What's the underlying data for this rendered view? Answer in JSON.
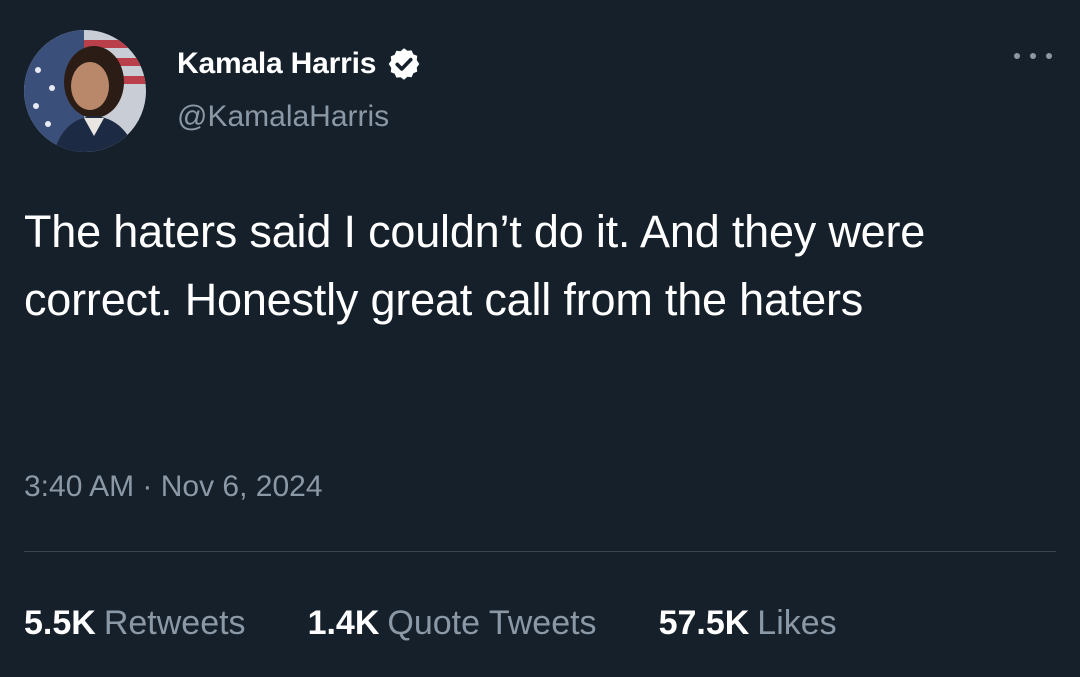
{
  "author": {
    "display_name": "Kamala Harris",
    "handle": "@KamalaHarris",
    "verified": true
  },
  "tweet": {
    "text": "The haters said I couldn’t do it. And they were correct. Honestly great call from the haters",
    "timestamp": "3:40 AM · Nov 6, 2024"
  },
  "stats": [
    {
      "count": "5.5K",
      "label": "Retweets"
    },
    {
      "count": "1.4K",
      "label": "Quote Tweets"
    },
    {
      "count": "57.5K",
      "label": "Likes"
    }
  ],
  "icons": {
    "verified": "verified-badge-icon",
    "more": "more-options-icon"
  },
  "colors": {
    "background": "#15202b",
    "primary_text": "#ffffff",
    "secondary_text": "#8b98a5",
    "divider": "#38444d"
  }
}
